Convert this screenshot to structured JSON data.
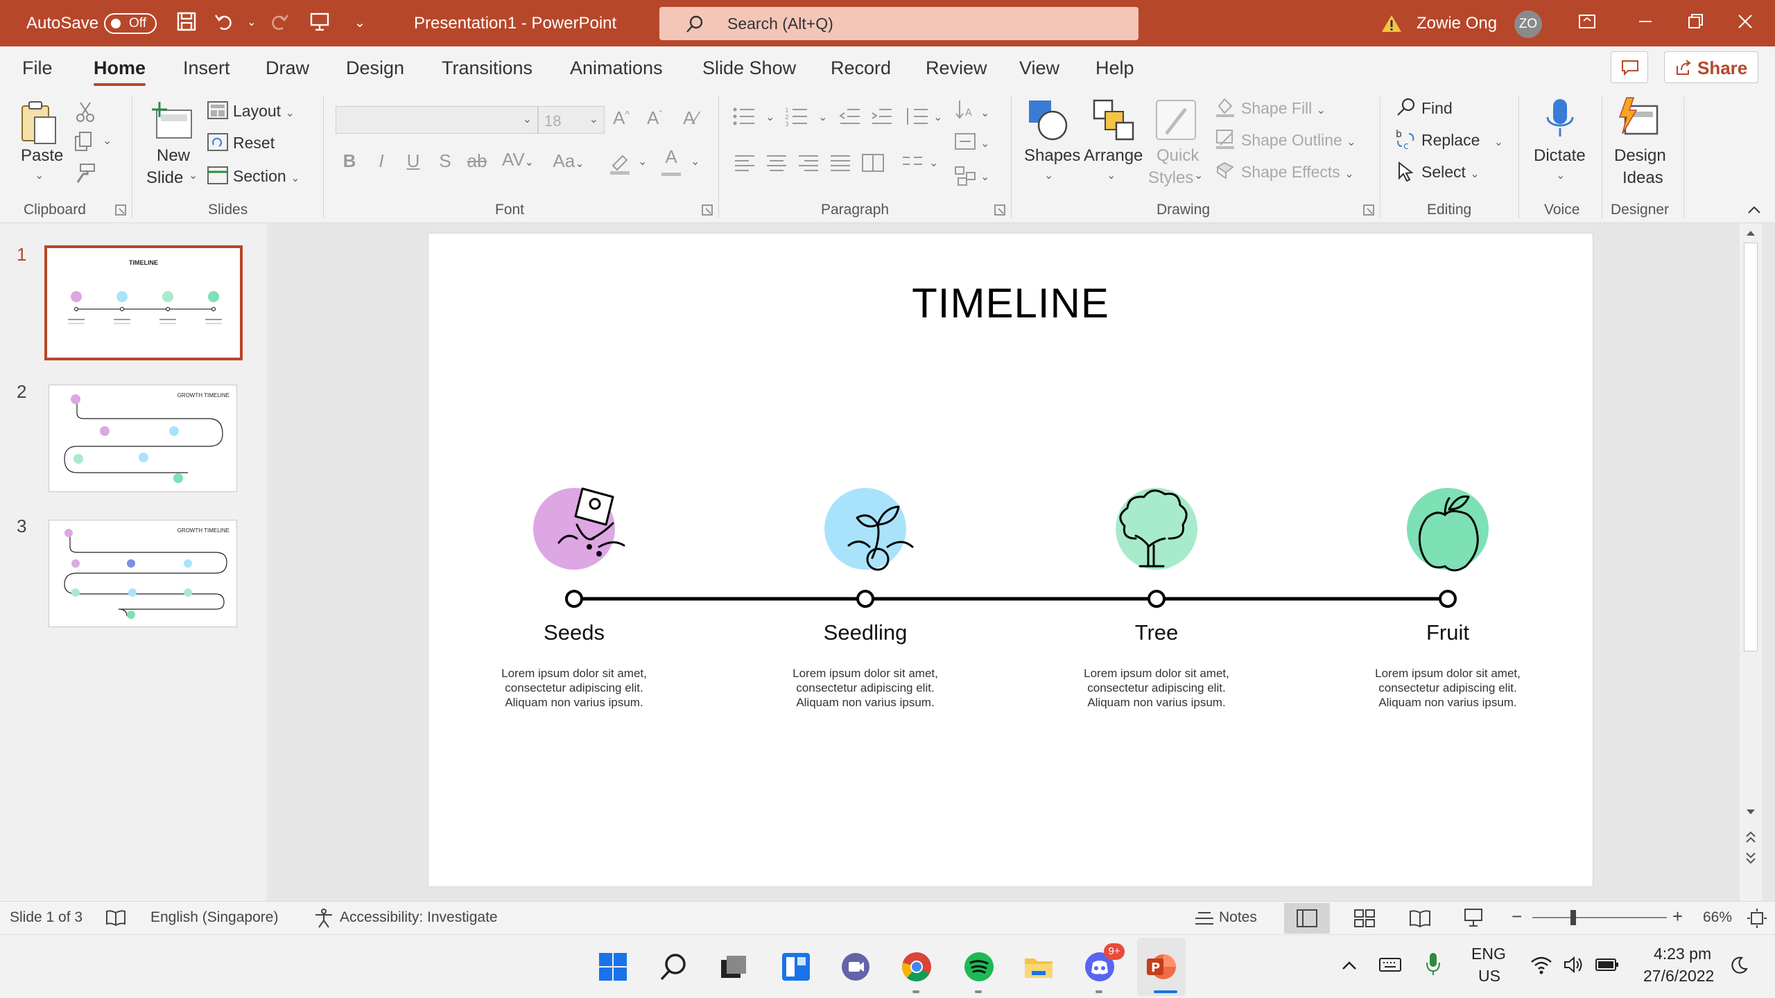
{
  "titlebar": {
    "autosave_label": "AutoSave",
    "autosave_state": "Off",
    "document_title": "Presentation1  -  PowerPoint",
    "search_placeholder": "Search (Alt+Q)",
    "user_name": "Zowie Ong",
    "user_initials": "ZO"
  },
  "menu": {
    "tabs": [
      "File",
      "Home",
      "Insert",
      "Draw",
      "Design",
      "Transitions",
      "Animations",
      "Slide Show",
      "Record",
      "Review",
      "View",
      "Help"
    ],
    "active": "Home",
    "share_label": "Share"
  },
  "ribbon": {
    "clipboard": {
      "label": "Clipboard",
      "paste": "Paste"
    },
    "slides": {
      "label": "Slides",
      "new_slide_line1": "New",
      "new_slide_line2": "Slide",
      "layout": "Layout",
      "reset": "Reset",
      "section": "Section"
    },
    "font": {
      "label": "Font",
      "size": "18",
      "bold": "B",
      "italic": "I",
      "underline": "U",
      "strike": "S",
      "case": "Aa"
    },
    "paragraph": {
      "label": "Paragraph"
    },
    "drawing": {
      "label": "Drawing",
      "shapes": "Shapes",
      "arrange": "Arrange",
      "quick_styles_line1": "Quick",
      "quick_styles_line2": "Styles",
      "shape_fill": "Shape Fill",
      "shape_outline": "Shape Outline",
      "shape_effects": "Shape Effects"
    },
    "editing": {
      "label": "Editing",
      "find": "Find",
      "replace": "Replace",
      "select": "Select"
    },
    "voice": {
      "label": "Voice",
      "dictate": "Dictate"
    },
    "designer": {
      "label": "Designer",
      "design_ideas_line1": "Design",
      "design_ideas_line2": "Ideas"
    }
  },
  "thumbnails": [
    {
      "number": "1",
      "title": "TIMELINE"
    },
    {
      "number": "2",
      "title": "GROWTH TIMELINE"
    },
    {
      "number": "3",
      "title": "GROWTH TIMELINE"
    }
  ],
  "slide": {
    "title": "TIMELINE",
    "stages": [
      {
        "label": "Seeds",
        "desc_line1": "Lorem ipsum dolor sit amet,",
        "desc_line2": "consectetur adipiscing elit.",
        "desc_line3": "Aliquam non varius ipsum.",
        "color": "#dca7e3",
        "icon": "seed-packet-icon"
      },
      {
        "label": "Seedling",
        "desc_line1": "Lorem ipsum dolor sit amet,",
        "desc_line2": "consectetur adipiscing elit.",
        "desc_line3": "Aliquam non varius ipsum.",
        "color": "#a9e3fb",
        "icon": "seedling-icon"
      },
      {
        "label": "Tree",
        "desc_line1": "Lorem ipsum dolor sit amet,",
        "desc_line2": "consectetur adipiscing elit.",
        "desc_line3": "Aliquam non varius ipsum.",
        "color": "#a7ebcc",
        "icon": "tree-icon"
      },
      {
        "label": "Fruit",
        "desc_line1": "Lorem ipsum dolor sit amet,",
        "desc_line2": "consectetur adipiscing elit.",
        "desc_line3": "Aliquam non varius ipsum.",
        "color": "#7ee0b5",
        "icon": "apple-icon"
      }
    ]
  },
  "statusbar": {
    "slide_info": "Slide 1 of 3",
    "language": "English (Singapore)",
    "accessibility": "Accessibility: Investigate",
    "notes": "Notes",
    "zoom": "66%"
  },
  "taskbar": {
    "discord_badge": "9+",
    "lang_line1": "ENG",
    "lang_line2": "US",
    "time": "4:23 pm",
    "date": "27/6/2022"
  },
  "colors": {
    "accent": "#b7472a"
  }
}
